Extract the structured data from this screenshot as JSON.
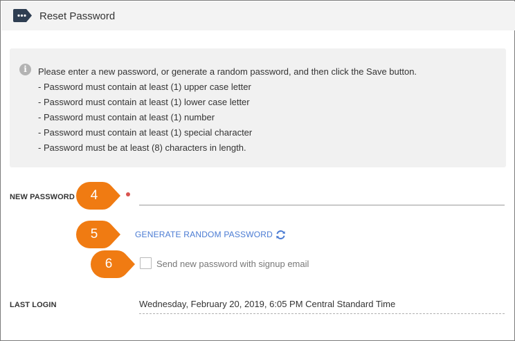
{
  "header": {
    "title": "Reset Password",
    "icon": "ellipsis-tag-icon"
  },
  "info": {
    "icon": "info-icon",
    "icon_glyph": "i",
    "lines": [
      "Please enter a new password, or generate a random password, and then click the Save button.",
      "- Password must contain at least (1) upper case letter",
      "- Password must contain at least (1) lower case letter",
      "- Password must contain at least (1) number",
      "- Password must contain at least (1) special character",
      "- Password must be at least (8) characters in length."
    ]
  },
  "form": {
    "new_password_label": "NEW PASSWORD",
    "new_password_value": "",
    "generate_label": "GENERATE RANDOM PASSWORD",
    "checkbox_label": "Send new password with signup email",
    "checkbox_checked": false,
    "last_login_label": "LAST LOGIN",
    "last_login_value": "Wednesday, February 20, 2019, 6:05 PM Central Standard Time"
  },
  "callouts": [
    "4",
    "5",
    "6"
  ],
  "colors": {
    "callout": "#f07b12",
    "link": "#4a7bd3",
    "required": "#d9534f",
    "header_bg": "#f3f3f3",
    "info_bg": "#f1f1f1"
  }
}
